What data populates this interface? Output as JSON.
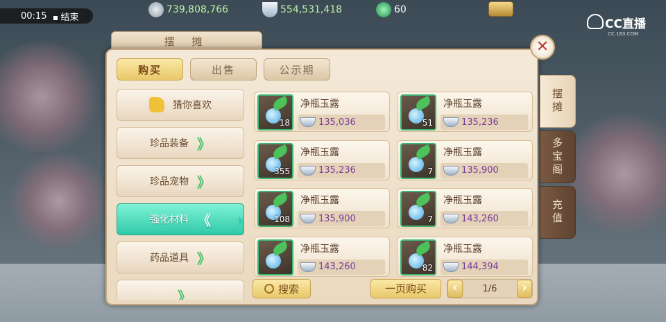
{
  "status": {
    "timer": "00:15",
    "end_label": "结束"
  },
  "currencies": [
    {
      "icon": "gold-coin-icon",
      "value": "739,808,766"
    },
    {
      "icon": "silver-ingot-icon",
      "value": "554,531,418"
    },
    {
      "icon": "jade-icon",
      "value": "60"
    }
  ],
  "watermark": {
    "main": "CC直播",
    "sub": "CC.163.COM"
  },
  "panel": {
    "title": "摆 摊",
    "close": "✕",
    "tabs": [
      {
        "label": "购买",
        "active": true
      },
      {
        "label": "出售",
        "active": false
      },
      {
        "label": "公示期",
        "active": false
      }
    ],
    "categories": [
      {
        "label": "猜你喜欢",
        "icon": "thumbs-up-icon"
      },
      {
        "label": "珍品装备",
        "arrow": "》"
      },
      {
        "label": "珍品宠物",
        "arrow": "》"
      },
      {
        "label": "强化材料",
        "arrow": "《",
        "active": true
      },
      {
        "label": "药品道具",
        "arrow": "》"
      },
      {
        "label": "",
        "arrow": "》"
      }
    ],
    "items": [
      {
        "name": "净瓶玉露",
        "qty": "18",
        "price": "135,036"
      },
      {
        "name": "净瓶玉露",
        "qty": "51",
        "price": "135,236"
      },
      {
        "name": "净瓶玉露",
        "qty": "355",
        "price": "135,236"
      },
      {
        "name": "净瓶玉露",
        "qty": "7",
        "price": "135,900"
      },
      {
        "name": "净瓶玉露",
        "qty": "108",
        "price": "135,900"
      },
      {
        "name": "净瓶玉露",
        "qty": "7",
        "price": "143,260"
      },
      {
        "name": "净瓶玉露",
        "qty": "",
        "price": "143,260"
      },
      {
        "name": "净瓶玉露",
        "qty": "82",
        "price": "144,394"
      }
    ],
    "search_label": "搜索",
    "buy_page_label": "一页购买",
    "pager": {
      "prev": "‹",
      "text": "1/6",
      "next": "›"
    }
  },
  "side_tabs": [
    {
      "label": "摆摊",
      "active": true
    },
    {
      "label": "多宝阁",
      "active": false
    },
    {
      "label": "充值",
      "active": false
    }
  ],
  "colors": {
    "accent": "#33d0ad",
    "price": "#7b3d99",
    "gold_button": "#e8c86a"
  }
}
